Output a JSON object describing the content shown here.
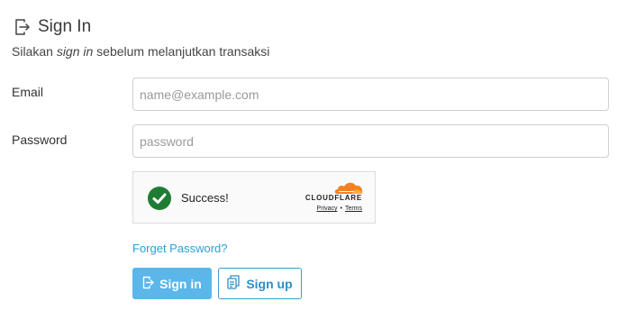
{
  "header": {
    "title": "Sign In",
    "subtitle_prefix": "Silakan ",
    "subtitle_em": "sign in",
    "subtitle_suffix": " sebelum melanjutkan transaksi"
  },
  "form": {
    "email": {
      "label": "Email",
      "placeholder": "name@example.com",
      "value": ""
    },
    "password": {
      "label": "Password",
      "placeholder": "password",
      "value": ""
    }
  },
  "turnstile": {
    "status": "Success!",
    "brand": "CLOUDFLARE",
    "privacy_label": "Privacy",
    "separator": "•",
    "terms_label": "Terms",
    "check_color": "#1e7d32",
    "cloud_color": "#f48120"
  },
  "links": {
    "forget_password": "Forget Password?"
  },
  "buttons": {
    "signin_label": "Sign in",
    "signup_label": "Sign up"
  },
  "colors": {
    "primary": "#5bb6ea",
    "link": "#2e9fd6"
  }
}
